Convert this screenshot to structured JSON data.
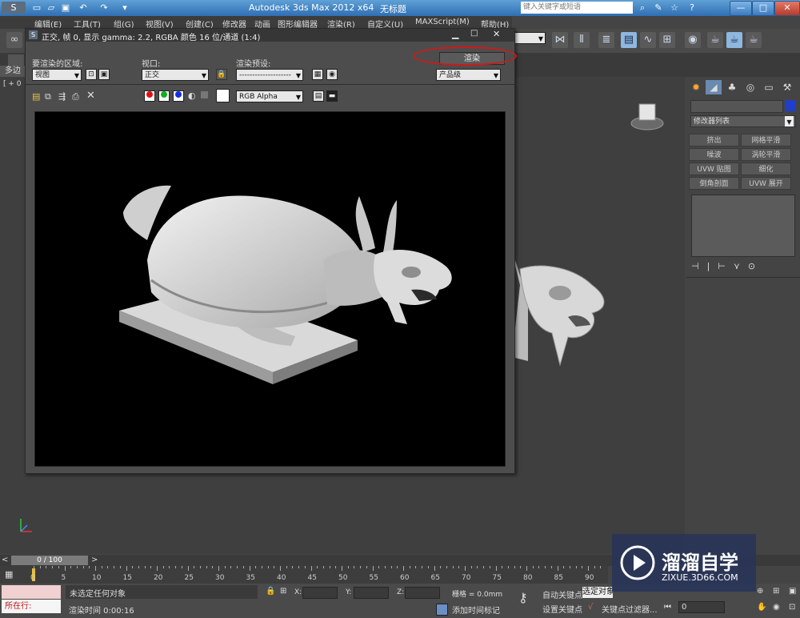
{
  "app": {
    "title": "Autodesk 3ds Max  2012 x64",
    "file": "无标题",
    "search_placeholder": "键入关键字或短语",
    "window_buttons": [
      "—",
      "□",
      "✕"
    ]
  },
  "menu": [
    "编辑(E)",
    "工具(T)",
    "组(G)",
    "视图(V)",
    "创建(C)",
    "修改器",
    "动画",
    "图形编辑器",
    "渲染(R)",
    "自定义(U)",
    "MAXScript(M)",
    "帮助(H)"
  ],
  "left_tab": "多边",
  "viewport_label": "[ + 0",
  "render_window": {
    "title": "正交, 帧 0, 显示 gamma: 2.2, RGBA 颜色 16 位/通道 (1:4)",
    "area_label": "要渲染的区域:",
    "area_value": "视图",
    "viewport_label": "视口:",
    "viewport_value": "正交",
    "preset_label": "渲染预设:",
    "preset_value": "--------------------",
    "render_button": "渲染",
    "quality_value": "产品级",
    "channel_value": "RGB Alpha",
    "colors": {
      "red": "#e01010",
      "green": "#10b020",
      "blue": "#1030e0",
      "highlight": "#d21818"
    }
  },
  "command_panel": {
    "modifier_list": "修改器列表",
    "buttons": [
      "挤出",
      "网格平滑",
      "噪波",
      "涡轮平滑",
      "UVW 贴图",
      "细化",
      "倒角剖面",
      "UVW 展开"
    ]
  },
  "timeline": {
    "position": "0 / 100",
    "ticks": [
      "0",
      "5",
      "10",
      "15",
      "20",
      "25",
      "30",
      "35",
      "40",
      "45",
      "50",
      "55",
      "60",
      "65",
      "70",
      "75",
      "80",
      "85",
      "90"
    ]
  },
  "status": {
    "mini_listener": "所在行:",
    "selection": "未选定任何对象",
    "render_time": "渲染时间  0:00:16",
    "x_label": "X:",
    "y_label": "Y:",
    "z_label": "Z:",
    "grid": "栅格 = 0.0mm",
    "add_time_tag": "添加时间标记",
    "auto_key": "自动关键点",
    "set_key": "设置关键点",
    "selected": "选定对象",
    "key_filters": "关键点过滤器...",
    "frame": "0"
  },
  "watermark": {
    "brand": "溜溜自学",
    "url": "ZIXUE.3D66.COM"
  }
}
